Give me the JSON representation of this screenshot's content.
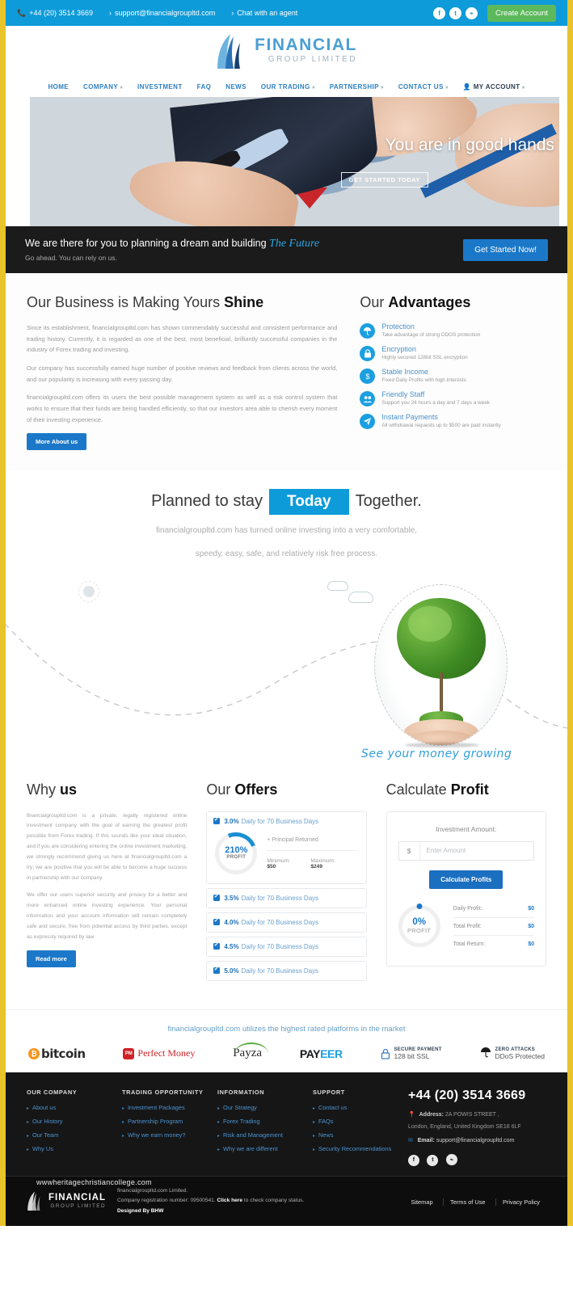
{
  "topbar": {
    "phone": "+44 (20) 3514 3669",
    "email": "support@financialgroupltd.com",
    "chat": "Chat with an agent",
    "social": [
      "f",
      "t",
      "r"
    ],
    "create_account": "Create Account"
  },
  "logo": {
    "line1": "FINANCIAL",
    "line2": "GROUP LIMITED"
  },
  "nav": [
    {
      "label": "HOME",
      "caret": false
    },
    {
      "label": "COMPANY",
      "caret": true
    },
    {
      "label": "INVESTMENT",
      "caret": false
    },
    {
      "label": "FAQ",
      "caret": false
    },
    {
      "label": "NEWS",
      "caret": false
    },
    {
      "label": "OUR TRADING",
      "caret": true
    },
    {
      "label": "PARTNERSHIP",
      "caret": true
    },
    {
      "label": "CONTACT US",
      "caret": true
    },
    {
      "label": "MY ACCOUNT",
      "caret": true,
      "account": true
    }
  ],
  "hero": {
    "caption": "You are in good hands",
    "button": "GET STARTED TODAY"
  },
  "cta": {
    "title_plain": "We are there for you to planning a dream and building ",
    "title_accent": "The Future",
    "subtitle": "Go ahead. You can rely on us.",
    "button": "Get Started Now!"
  },
  "about": {
    "title_plain": "Our Business is Making Yours ",
    "title_bold": "Shine",
    "paragraphs": [
      "Since its establishment, financialgroupltd.com has shown commendably successful and consistent performance and trading history. Currently, it is regarded as one of the best, most beneficial, brilliantly successful companies in the industry of Forex trading and investing.",
      "Our company has successfully earned huge number of positive reviews and feedback from clients across the world, and our popularity is increasing with every passing day.",
      "financialgroupltd.com offers its users the best possible management system as well as a risk control system that works to ensure that their funds are being handled efficiently, so that our investors area able to cherish every moment of their investing experience."
    ],
    "button": "More About us"
  },
  "advantages": {
    "title_plain": "Our ",
    "title_bold": "Advantages",
    "items": [
      {
        "icon": "umbrella-icon",
        "glyph": "☂",
        "title": "Protection",
        "desc": "Take advantage of strong DDOS protection"
      },
      {
        "icon": "lock-icon",
        "glyph": "🔒",
        "title": "Encryption",
        "desc": "Highly secured 128bit SSL encryption"
      },
      {
        "icon": "dollar-icon",
        "glyph": "$",
        "title": "Stable Income",
        "desc": "Fixed Daily Profits with high interests"
      },
      {
        "icon": "users-icon",
        "glyph": "👥",
        "title": "Friendly Staff",
        "desc": "Support you 24 hours a day and 7 days a week"
      },
      {
        "icon": "paper-plane-icon",
        "glyph": "➤",
        "title": "Instant Payments",
        "desc": "All withdrawal requests up to $500 are paid instantly"
      }
    ]
  },
  "today": {
    "pre": "Planned to stay",
    "highlight": "Today",
    "post": "Together.",
    "sub_line1": "financialgroupltd.com has turned online investing into a very comfortable,",
    "sub_line2": "speedy, easy, safe, and relatively risk free process."
  },
  "growth": {
    "caption": "See your money growing"
  },
  "why": {
    "title_plain": "Why ",
    "title_bold": "us",
    "paragraphs": [
      "financialgroupltd.com is a private, legally registered online investment company with the goal of earning the greatest profit possible from Forex trading. If this sounds like your ideal situation, and if you are considering entering the online investment marketing, we strongly recommend giving us here at financialgroupltd.com a try; we are positive that you will be able to become a huge success in partnership with our company.",
      "We offer our users superior security and privacy for a better and more enhanced online investing experience. Your personal information and your account information will remain completely safe and secure, free from potential access by third parties, except as expressly required by law."
    ],
    "button": "Read more"
  },
  "offers": {
    "title_plain": "Our ",
    "title_bold": "Offers",
    "featured": {
      "rate": "3.0%",
      "term": "Daily for 70 Business Days",
      "profit_value": "210%",
      "profit_label": "PROFIT",
      "principal": "+ Principal Returned",
      "minimum_label": "Minimum:",
      "minimum_value": "$50",
      "maximum_label": "Maximum:",
      "maximum_value": "$249"
    },
    "rows": [
      {
        "rate": "3.5%",
        "term": "Daily for 70 Business Days"
      },
      {
        "rate": "4.0%",
        "term": "Daily for 70 Business Days"
      },
      {
        "rate": "4.5%",
        "term": "Daily for 70 Business Days"
      },
      {
        "rate": "5.0%",
        "term": "Daily for 70 Business Days"
      }
    ]
  },
  "calculator": {
    "title_plain": "Calculate ",
    "title_bold": "Profit",
    "label": "Investment Amount:",
    "currency": "$",
    "placeholder": "Enter Amount",
    "value": "",
    "button": "Calculate Profits",
    "profit_value": "0%",
    "profit_label": "PROFIT",
    "results": [
      {
        "label": "Daily Profit:",
        "value": "$0"
      },
      {
        "label": "Total Profit:",
        "value": "$0"
      },
      {
        "label": "Total Return:",
        "value": "$0"
      }
    ]
  },
  "partners": {
    "heading": "financialgroupltd.com utilizes the highest rated platforms in the market",
    "logos": [
      {
        "name": "bitcoin-logo",
        "text": "bitcoin",
        "mark": "₿"
      },
      {
        "name": "perfect-money-logo",
        "text": "Perfect Money",
        "mark": "PM"
      },
      {
        "name": "payza-logo",
        "text": "Payza"
      },
      {
        "name": "payeer-logo",
        "text_a": "PAY",
        "text_b": "EER"
      },
      {
        "name": "secure-payment-badge",
        "t1": "SECURE PAYMENT",
        "t2": "128 bit SSL"
      },
      {
        "name": "zero-attacks-badge",
        "t1": "ZERO ATTACKS",
        "t2": "DDoS Protected"
      }
    ]
  },
  "footer": {
    "columns": [
      {
        "title": "OUR COMPANY",
        "links": [
          "About us",
          "Our History",
          "Our Team",
          "Why Us"
        ]
      },
      {
        "title": "TRADING OPPORTUNITY",
        "links": [
          "Investment Packages",
          "Partnership Program",
          "Why we earn money?"
        ]
      },
      {
        "title": "INFORMATION",
        "links": [
          "Our Strategy",
          "Forex Trading",
          "Risk and Management",
          "Why we are different"
        ]
      },
      {
        "title": "SUPPORT",
        "links": [
          "Contact us",
          "FAQs",
          "News",
          "Security Recommendations"
        ]
      }
    ],
    "contact": {
      "phone": "+44 (20) 3514 3669",
      "address_label": "Address:",
      "address_line1": "2A POWIS STREET ,",
      "address_line2": "London, England, United Kingdom SE18 6LF",
      "email_label": "Email:",
      "email_value": "support@financialgroupltd.com",
      "social": [
        "f",
        "t",
        "r"
      ]
    }
  },
  "bottom": {
    "watermark": "wwwheritagechristiancollege.com",
    "logo_line1": "FINANCIAL",
    "logo_line2": "GROUP LIMITED",
    "copy_line1": "financialgroupltd.com Limited.",
    "copy_line2_pre": "Company registration number: 09500541. ",
    "copy_line2_link": "Click here",
    "copy_line2_post": " to check company status.",
    "copy_line3": "Designed By BHW",
    "links": [
      "Sitemap",
      "Terms of Use",
      "Privacy Policy"
    ]
  }
}
